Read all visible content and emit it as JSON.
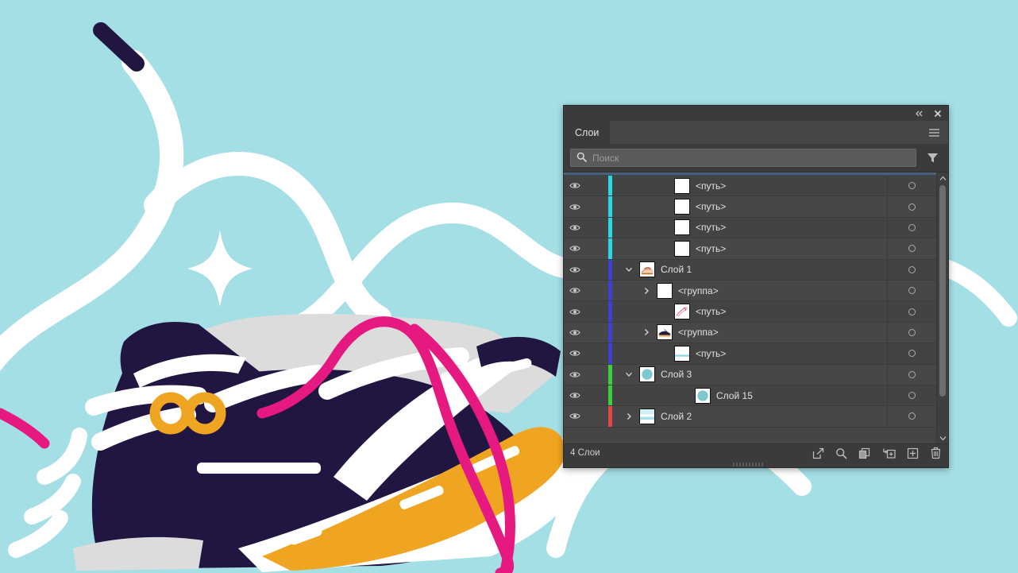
{
  "panel": {
    "title": "Слои",
    "titlebar": {
      "collapse_icon": "double-chevron-left-icon",
      "close_icon": "close-icon"
    },
    "menu_icon": "hamburger-menu-icon",
    "search": {
      "placeholder": "Поиск",
      "value": "",
      "icon": "search-icon"
    },
    "filter_icon": "filter-funnel-icon",
    "footer": {
      "count_label": "4 Слои",
      "icons": [
        "release-to-layers-icon",
        "locate-object-icon",
        "clipping-mask-icon",
        "new-sublayer-icon",
        "new-layer-icon",
        "delete-layer-icon"
      ]
    },
    "colors": {
      "panel_bg": "#3b3b3b",
      "list_bg": "#454545",
      "row_alt_bg": "#434343",
      "text": "#e0e0e0",
      "selection_band": "#4b6079"
    },
    "rows": [
      {
        "name": "<путь>",
        "indent": 2,
        "color": "#2ad8e0",
        "twisty": "",
        "thumb": "white-blank",
        "visible": true,
        "target": true
      },
      {
        "name": "<путь>",
        "indent": 2,
        "color": "#2ad8e0",
        "twisty": "",
        "thumb": "white-blank",
        "visible": true,
        "target": true
      },
      {
        "name": "<путь>",
        "indent": 2,
        "color": "#2ad8e0",
        "twisty": "",
        "thumb": "white-blank",
        "visible": true,
        "target": true
      },
      {
        "name": "<путь>",
        "indent": 2,
        "color": "#2ad8e0",
        "twisty": "",
        "thumb": "white-blank",
        "visible": true,
        "target": true
      },
      {
        "name": "Слой 1",
        "indent": 0,
        "color": "#4040d8",
        "twisty": "down",
        "thumb": "sneaker-light",
        "visible": true,
        "target": true
      },
      {
        "name": "<группа>",
        "indent": 1,
        "color": "#4040d8",
        "twisty": "right",
        "thumb": "white-blank",
        "visible": true,
        "target": true
      },
      {
        "name": "<путь>",
        "indent": 2,
        "color": "#4040d8",
        "twisty": "",
        "thumb": "pink-stroke",
        "visible": true,
        "target": true
      },
      {
        "name": "<группа>",
        "indent": 1,
        "color": "#4040d8",
        "twisty": "right",
        "thumb": "sneaker-dark",
        "visible": true,
        "target": true
      },
      {
        "name": "<путь>",
        "indent": 2,
        "color": "#4040d8",
        "twisty": "",
        "thumb": "cyan-band",
        "visible": true,
        "target": true
      },
      {
        "name": "Слой 3",
        "indent": 0,
        "color": "#3ccf3c",
        "twisty": "down",
        "thumb": "teal-circle",
        "visible": true,
        "target": true
      },
      {
        "name": "Слой 15",
        "indent": 2,
        "color": "#3ccf3c",
        "twisty": "",
        "thumb": "teal-circle",
        "visible": true,
        "target": true
      },
      {
        "name": "Слой 2",
        "indent": 0,
        "color": "#e84545",
        "twisty": "right",
        "thumb": "cyan-split",
        "visible": true,
        "target": true
      }
    ],
    "scrollbar": {
      "up_icon": "chevron-up-icon",
      "down_icon": "chevron-down-icon"
    }
  },
  "artwork": {
    "description": "Сникер иллюстрация",
    "colors": {
      "background": "#a5dfe6",
      "navy": "#211641",
      "white": "#ffffff",
      "gray": "#dcdcdc",
      "orange": "#f0a522",
      "pink": "#e5197f"
    }
  }
}
